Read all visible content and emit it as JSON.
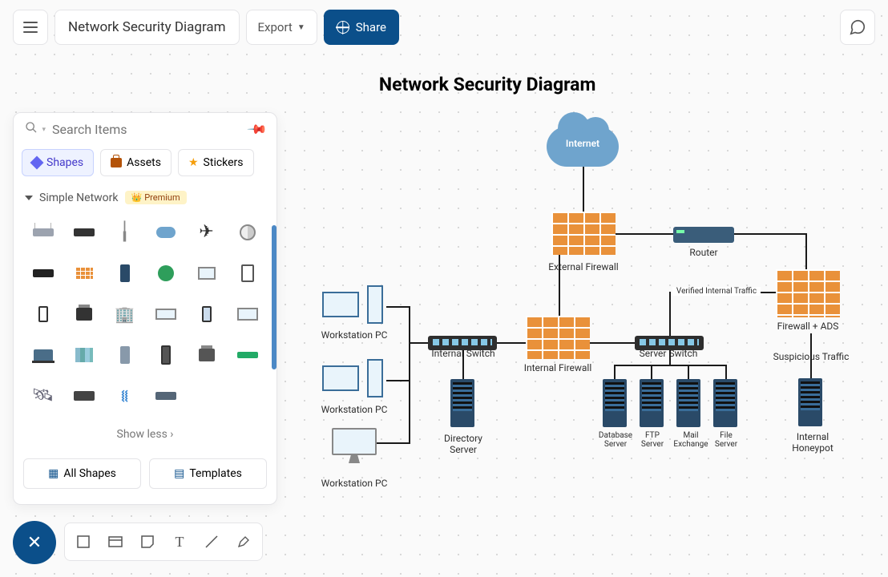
{
  "header": {
    "title": "Network Security Diagram",
    "export_label": "Export",
    "share_label": "Share"
  },
  "panel": {
    "search_placeholder": "Search Items",
    "tabs": {
      "shapes": "Shapes",
      "assets": "Assets",
      "stickers": "Stickers"
    },
    "section_name": "Simple Network",
    "premium_badge": "Premium",
    "show_less": "Show less",
    "all_shapes": "All Shapes",
    "templates": "Templates",
    "shapes": [
      "wifi-router-icon",
      "rack-switch-icon",
      "antenna-tower-icon",
      "cloud-icon",
      "jet-icon",
      "satellite-dish-icon",
      "switch-bar-icon",
      "firewall-icon",
      "server-tower-icon",
      "globe-icon",
      "monitor-icon",
      "tablet-icon",
      "smartphone-icon",
      "fax-icon",
      "building-icon",
      "widescreen-icon",
      "phone-flat-icon",
      "tv-icon",
      "laptop-icon",
      "cityscape-icon",
      "server-rack-icon",
      "cordless-phone-icon",
      "printer-icon",
      "modem-icon",
      "satellite-icon",
      "hard-drive-icon",
      "wifi-signal-icon",
      "network-hub-icon"
    ]
  },
  "tools": [
    "rectangle-tool",
    "frame-tool",
    "sticky-note-tool",
    "text-tool",
    "line-tool",
    "pen-tool"
  ],
  "diagram": {
    "title": "Network Security Diagram",
    "nodes": {
      "internet": "Internet",
      "external_fw": "External Firewall",
      "router": "Router",
      "internal_switch": "Internal Switch",
      "internal_fw": "Internal Firewall",
      "server_switch": "Server Switch",
      "fw_ads": "Firewall + ADS",
      "ws1": "Workstation PC",
      "ws2": "Workstation PC",
      "ws3": "Workstation PC",
      "directory": "Directory\nServer",
      "db": "Database\nServer",
      "ftp": "FTP\nServer",
      "mail": "Mail\nExchange",
      "file": "File\nServer",
      "honeypot": "Internal\nHoneypot",
      "verified": "Verified Internal Traffic",
      "suspicious": "Suspicious Traffic"
    }
  }
}
